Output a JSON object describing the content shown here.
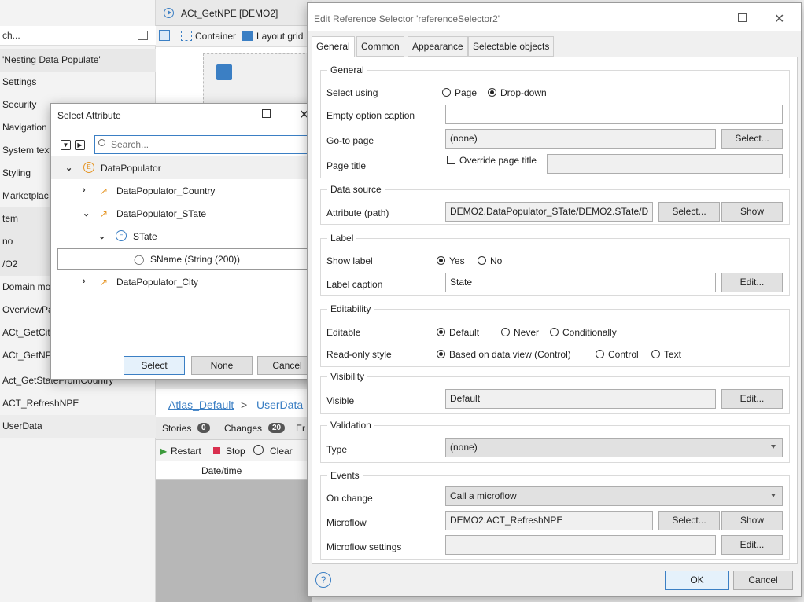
{
  "sidebar": {
    "search_text": "ch...",
    "items": [
      {
        "label": "'Nesting Data Populate'"
      },
      {
        "label": "Settings"
      },
      {
        "label": "Security"
      },
      {
        "label": "Navigation"
      },
      {
        "label": "System text"
      },
      {
        "label": "Styling"
      },
      {
        "label": "Marketplac"
      },
      {
        "label": "tem"
      },
      {
        "label": "no"
      },
      {
        "label": "/O2"
      },
      {
        "label": "Domain mo"
      },
      {
        "label": "OverviewPa"
      },
      {
        "label": "ACt_GetCity"
      },
      {
        "label": "ACt_GetNP"
      },
      {
        "label": "Act_GetStateFromCountry"
      },
      {
        "label": "ACT_RefreshNPE"
      },
      {
        "label": "UserData"
      }
    ]
  },
  "editor": {
    "tab_title": "ACt_GetNPE [DEMO2]",
    "toolbar": {
      "container": "Container",
      "layout_grid": "Layout grid"
    },
    "breadcrumb": {
      "layout": "Atlas_Default",
      "sep": ">",
      "page": "UserData"
    },
    "stories_tab": {
      "stories": "Stories",
      "stories_count": "0",
      "changes": "Changes",
      "changes_count": "20",
      "errors_stub": "Er"
    },
    "console": {
      "restart": "Restart",
      "stop": "Stop",
      "clear": "Clear",
      "col_datetime": "Date/time"
    }
  },
  "select_attribute": {
    "title": "Select Attribute",
    "search_placeholder": "Search...",
    "tree": [
      {
        "label": "DataPopulator",
        "kind": "entity"
      },
      {
        "label": "DataPopulator_Country",
        "kind": "association"
      },
      {
        "label": "DataPopulator_STate",
        "kind": "association"
      },
      {
        "label": "STate",
        "kind": "entity"
      },
      {
        "label": "SName (String (200))",
        "kind": "attribute"
      },
      {
        "label": "DataPopulator_City",
        "kind": "association"
      }
    ],
    "buttons": {
      "select": "Select",
      "none": "None",
      "cancel": "Cancel"
    }
  },
  "ref_selector": {
    "title": "Edit Reference Selector 'referenceSelector2'",
    "tabs": [
      "General",
      "Common",
      "Appearance",
      "Selectable objects"
    ],
    "general": {
      "caption": "General",
      "select_using": "Select using",
      "opt_page": "Page",
      "opt_dropdown": "Drop-down",
      "empty_caption_label": "Empty option caption",
      "empty_caption_value": "",
      "goto_label": "Go-to page",
      "goto_value": "(none)",
      "goto_btn": "Select...",
      "page_title_label": "Page title",
      "override_label": "Override page title"
    },
    "data_source": {
      "caption": "Data source",
      "attr_label": "Attribute (path)",
      "attr_value": "DEMO2.DataPopulator_STate/DEMO2.STate/D",
      "select_btn": "Select...",
      "show_btn": "Show"
    },
    "label": {
      "caption": "Label",
      "show_label": "Show label",
      "yes": "Yes",
      "no": "No",
      "caption_label": "Label caption",
      "caption_value": "State",
      "edit_btn": "Edit..."
    },
    "editability": {
      "caption": "Editability",
      "editable_label": "Editable",
      "opt_default": "Default",
      "opt_never": "Never",
      "opt_conditionally": "Conditionally",
      "readonly_label": "Read-only style",
      "opt_based": "Based on data view (Control)",
      "opt_control": "Control",
      "opt_text": "Text"
    },
    "visibility": {
      "caption": "Visibility",
      "visible_label": "Visible",
      "visible_value": "Default",
      "edit_btn": "Edit..."
    },
    "validation": {
      "caption": "Validation",
      "type_label": "Type",
      "type_value": "(none)"
    },
    "events": {
      "caption": "Events",
      "onchange_label": "On change",
      "onchange_value": "Call a microflow",
      "microflow_label": "Microflow",
      "microflow_value": "DEMO2.ACT_RefreshNPE",
      "select_btn": "Select...",
      "show_btn": "Show",
      "settings_label": "Microflow settings",
      "edit_btn": "Edit..."
    },
    "footer": {
      "ok": "OK",
      "cancel": "Cancel"
    }
  },
  "colors": {
    "accent": "#3b7fc4",
    "entity": "#e59524"
  }
}
